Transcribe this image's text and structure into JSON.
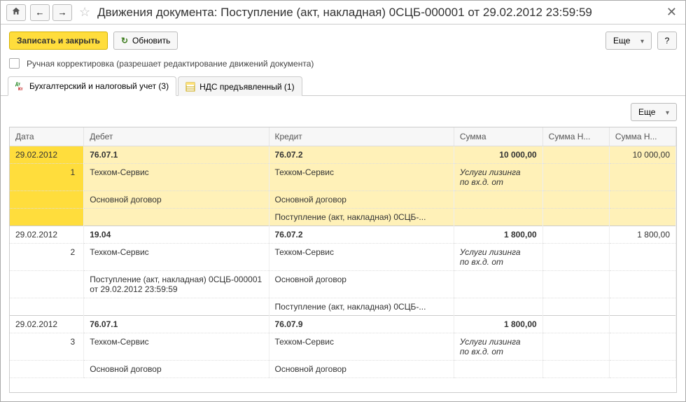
{
  "title": "Движения документа: Поступление (акт, накладная) 0СЦБ-000001 от 29.02.2012 23:59:59",
  "toolbar": {
    "save_close": "Записать и закрыть",
    "refresh": "Обновить",
    "more": "Еще",
    "help": "?"
  },
  "checkbox": {
    "label": "Ручная корректировка (разрешает редактирование движений документа)"
  },
  "tabs": [
    {
      "label": "Бухгалтерский и налоговый учет (3)"
    },
    {
      "label": "НДС предъявленный (1)"
    }
  ],
  "inner_toolbar": {
    "more": "Еще"
  },
  "columns": {
    "date": "Дата",
    "debit": "Дебет",
    "credit": "Кредит",
    "sum": "Сумма",
    "sum_nu1": "Сумма Н...",
    "sum_nu2": "Сумма Н..."
  },
  "rows": [
    {
      "selected": true,
      "date": "29.02.2012",
      "n": "1",
      "debit_acc": "76.07.1",
      "credit_acc": "76.07.2",
      "sum": "10 000,00",
      "sum_nu2": "10 000,00",
      "debit_lines": [
        "Техком-Сервис",
        "Основной договор"
      ],
      "credit_lines": [
        "Техком-Сервис",
        "Основной договор",
        "Поступление (акт, накладная) 0СЦБ-..."
      ],
      "note": "Услуги лизинга\nпо вх.д.  от"
    },
    {
      "selected": false,
      "date": "29.02.2012",
      "n": "2",
      "debit_acc": "19.04",
      "credit_acc": "76.07.2",
      "sum": "1 800,00",
      "sum_nu2": "1 800,00",
      "debit_lines": [
        "Техком-Сервис",
        "Поступление (акт, накладная) 0СЦБ-000001 от 29.02.2012 23:59:59"
      ],
      "credit_lines": [
        "Техком-Сервис",
        "Основной договор",
        "Поступление (акт, накладная) 0СЦБ-..."
      ],
      "note": "Услуги лизинга\nпо вх.д.  от"
    },
    {
      "selected": false,
      "date": "29.02.2012",
      "n": "3",
      "debit_acc": "76.07.1",
      "credit_acc": "76.07.9",
      "sum": "1 800,00",
      "sum_nu2": "",
      "debit_lines": [
        "Техком-Сервис",
        "Основной договор"
      ],
      "credit_lines": [
        "Техком-Сервис",
        "Основной договор"
      ],
      "note": "Услуги лизинга\nпо вх.д.  от"
    }
  ]
}
